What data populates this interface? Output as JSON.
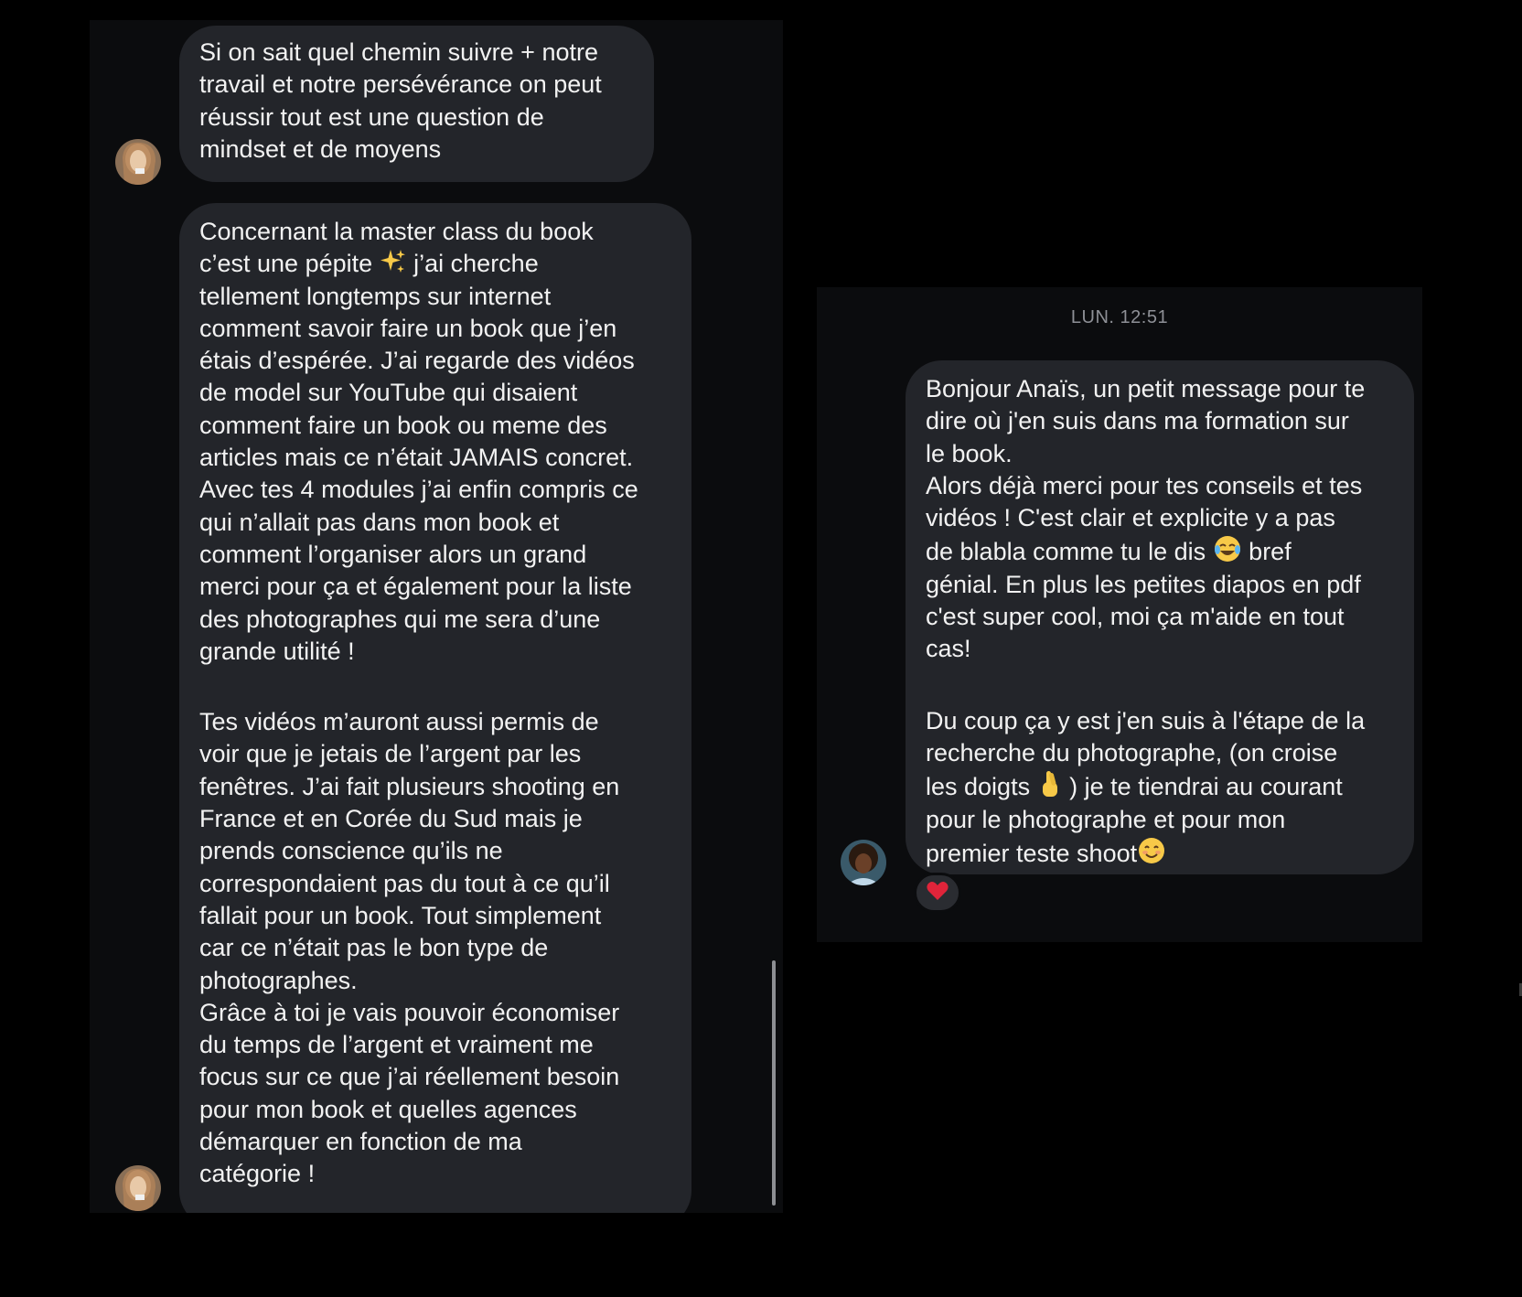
{
  "left_panel": {
    "message_1": "Si on sait quel chemin suivre + notre\ntravail et notre persévérance on peut\nréussir tout est une question de\nmindset et de moyens",
    "message_2": {
      "para_1_before_emoji": "Concernant la master class du book\nc’est une pépite ",
      "para_1_after_emoji": " j’ai cherche\ntellement longtemps sur internet\ncomment savoir faire un book que j’en\nétais d’espérée. J’ai regarde des vidéos\nde model sur YouTube qui disaient\ncomment faire un book ou meme des\narticles mais ce n’était JAMAIS concret.\nAvec tes 4 modules j’ai enfin compris ce\nqui n’allait pas dans mon book et\ncomment l’organiser alors un grand\nmerci pour ça et également pour la liste\ndes photographes qui me sera d’une\ngrande utilité !",
      "para_2": "Tes vidéos m’auront aussi permis de\nvoir que je jetais de l’argent par les\nfenêtres. J’ai fait plusieurs shooting en\nFrance et en Corée du Sud mais je\nprends conscience qu’ils ne\ncorrespondaient pas du tout à ce qu’il\nfallait pour un book. Tout simplement\ncar ce n’était pas le bon type de\nphotographes.\nGrâce à toi je vais pouvoir économiser\ndu temps de l’argent et vraiment me\nfocus sur ce que j’ai réellement besoin\npour mon book et quelles agences\ndémarquer en fonction de ma\ncatégorie !"
    }
  },
  "right_panel": {
    "timestamp": "LUN. 12:51",
    "message": {
      "para_1_before_emoji": "Bonjour Anaïs, un petit message pour te\ndire où j'en suis dans ma formation sur\nle book.\nAlors déjà merci pour tes conseils et tes\nvidéos ! C'est clair et explicite y a pas\nde blabla comme tu le dis ",
      "para_1_after_emoji": " bref\ngénial. En plus les petites diapos en pdf\nc'est super cool, moi ça m'aide en tout\ncas!",
      "para_2_before_emoji": "Du coup ça y est j'en suis à l'étape de la\nrecherche du photographe, (on croise\nles doigts ",
      "para_2_middle": " ) je te tiendrai au courant\npour le photographe et pour mon\npremier teste shoot",
      "reaction_icon": "red-heart",
      "emoji_icons": [
        "sparkles",
        "face-with-tears-of-joy",
        "crossed-fingers",
        "smiling-face"
      ]
    }
  },
  "colors": {
    "background": "#000000",
    "panel": "#0b0c0e",
    "bubble": "#23252a",
    "text": "#f2f2f2",
    "timestamp": "#8e9096",
    "heart": "#e0243a"
  }
}
